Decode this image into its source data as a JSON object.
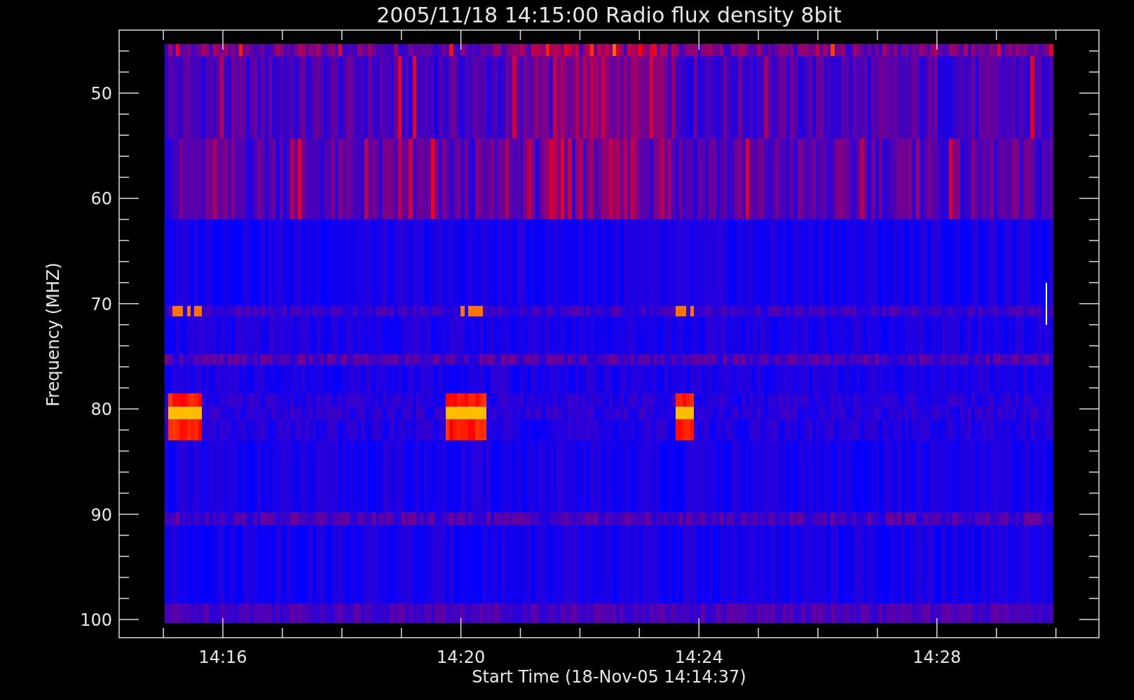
{
  "title": "2005/11/18 14:15:00 Radio flux density 8bit",
  "y_axis": {
    "label": "Frequency (MHZ)",
    "ticks": [
      "50",
      "60",
      "70",
      "80",
      "90",
      "100"
    ]
  },
  "x_axis": {
    "label": "Start Time (18-Nov-05 14:14:37)",
    "ticks": [
      "14:16",
      "14:20",
      "14:24",
      "14:28"
    ]
  }
}
